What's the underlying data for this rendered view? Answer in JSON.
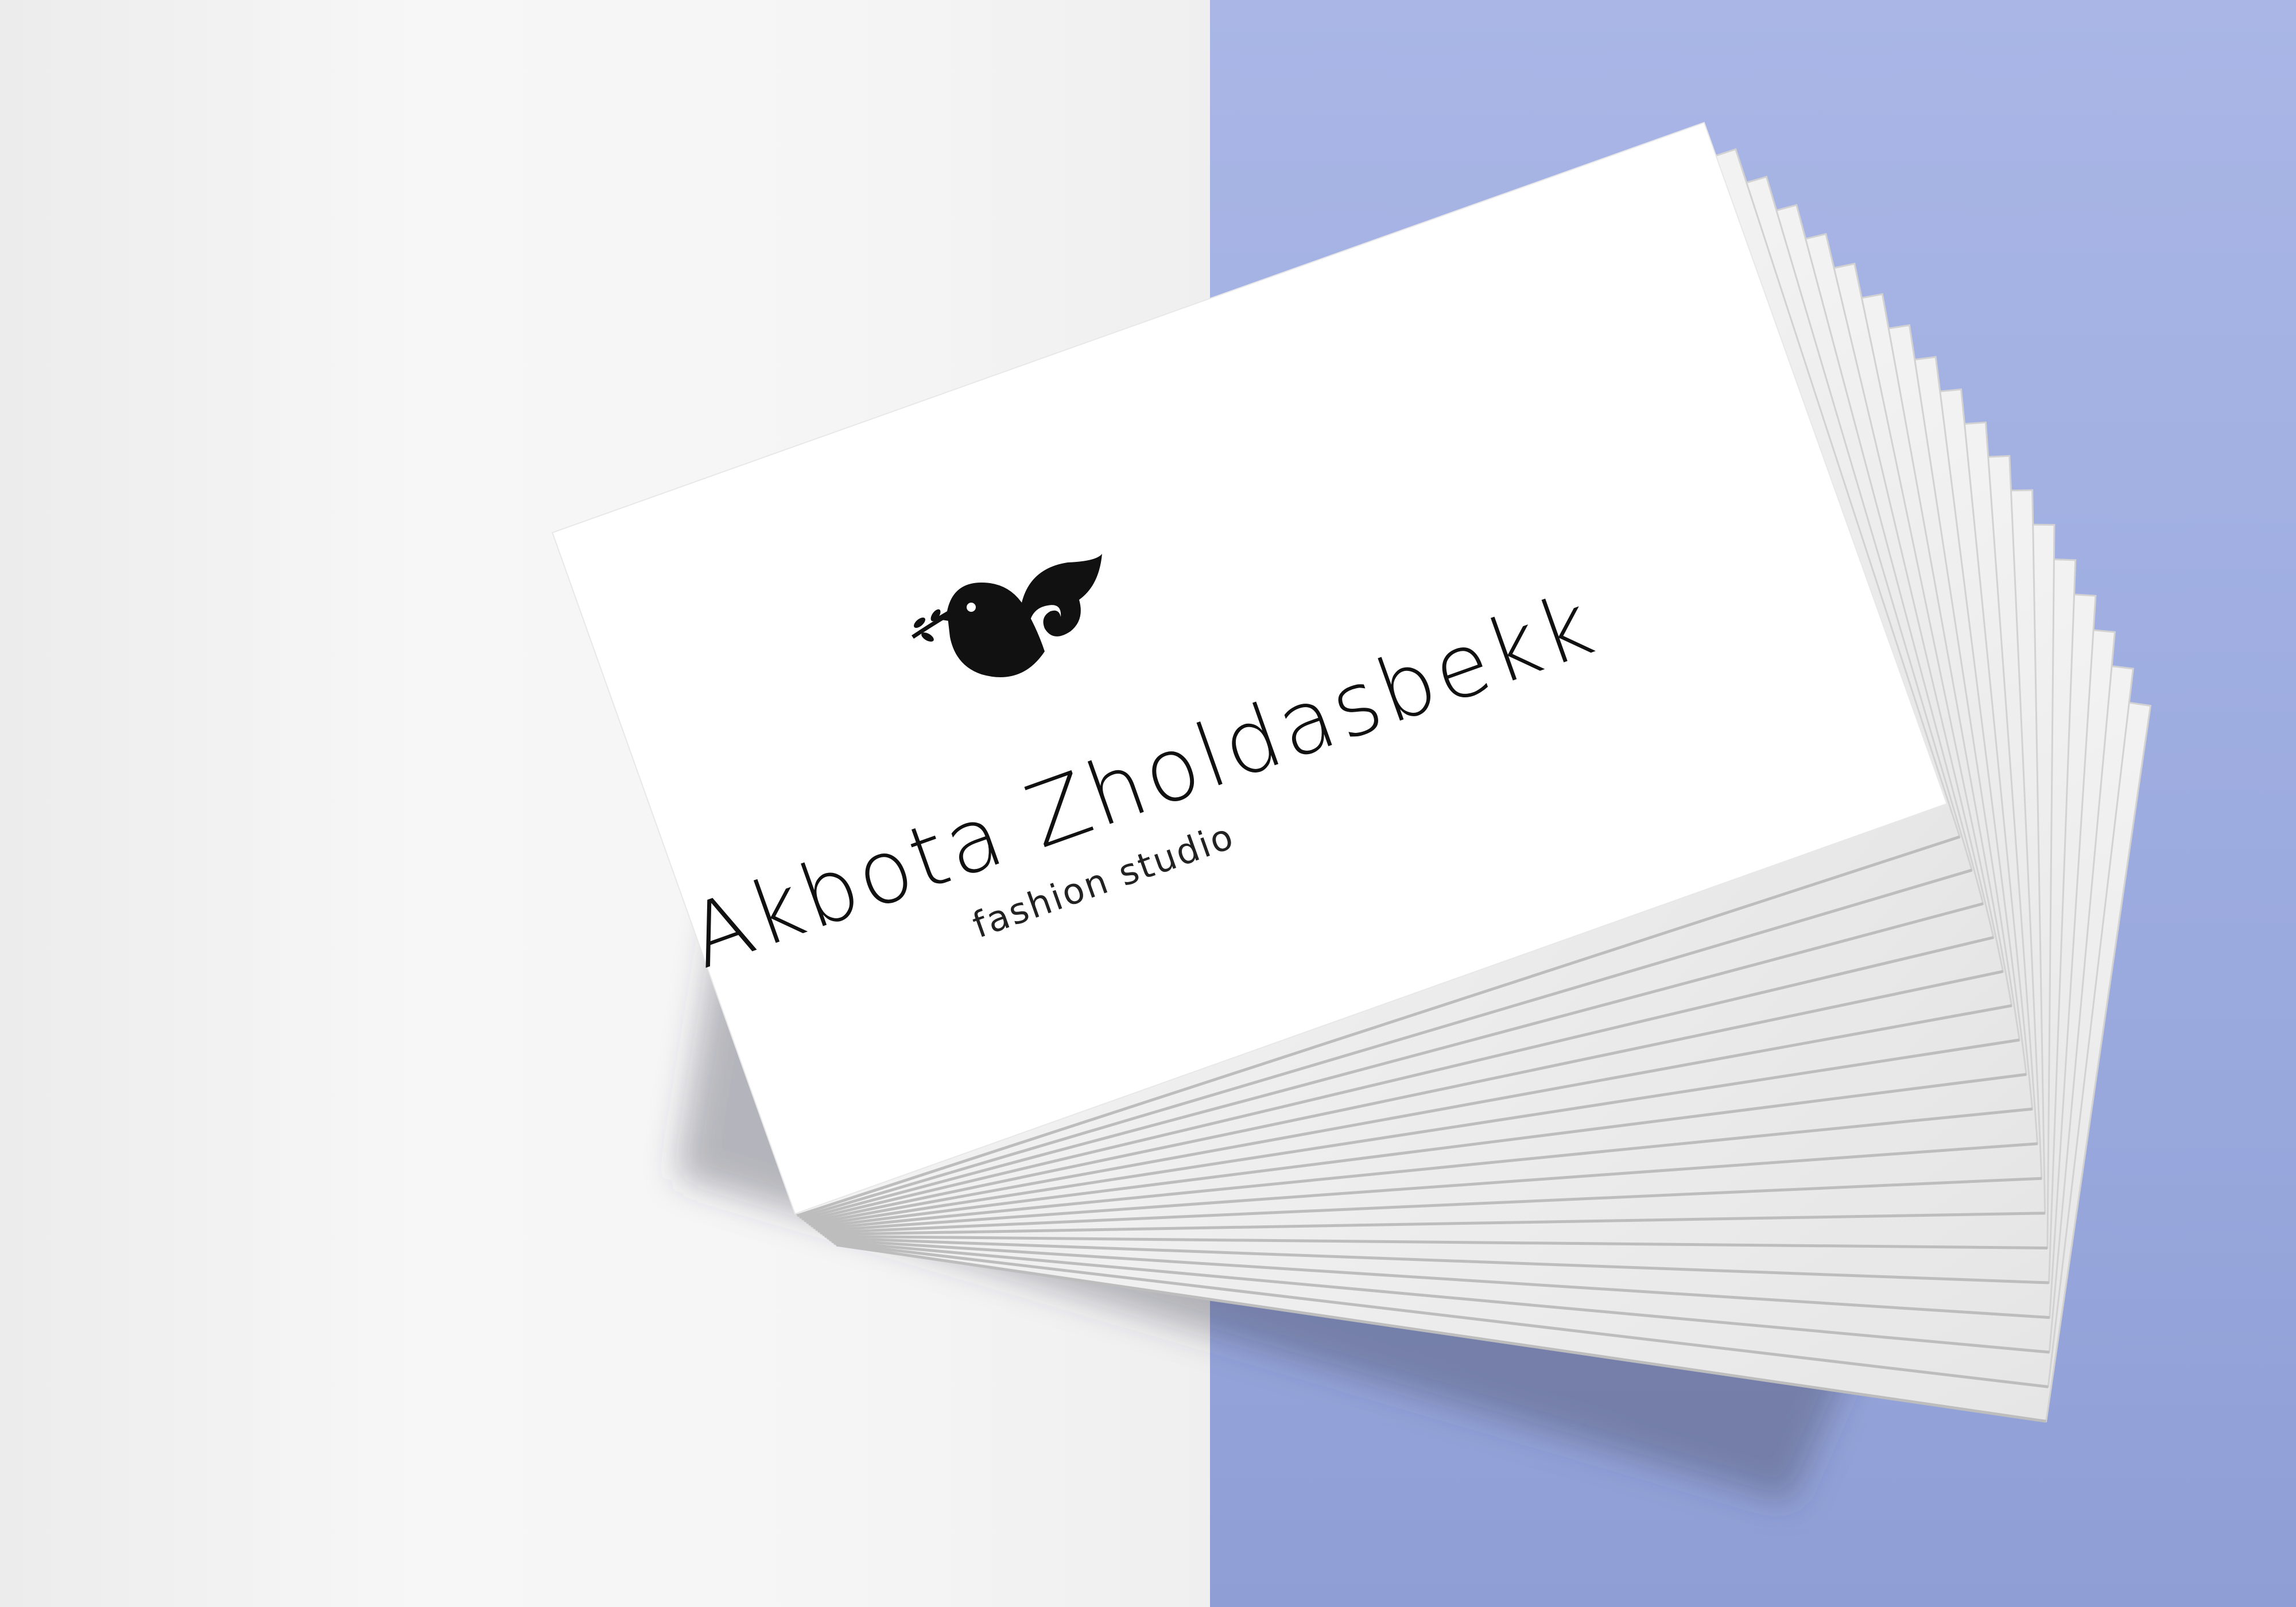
{
  "card": {
    "name": "Akbota Zholdasbekk",
    "tagline": "fashion studio",
    "logo_icon": "bird-with-branch-icon",
    "ink_color": "#111111",
    "card_color": "#ffffff"
  },
  "background": {
    "left_color": "#f3f3f3",
    "right_color": "#a3b0e3"
  }
}
